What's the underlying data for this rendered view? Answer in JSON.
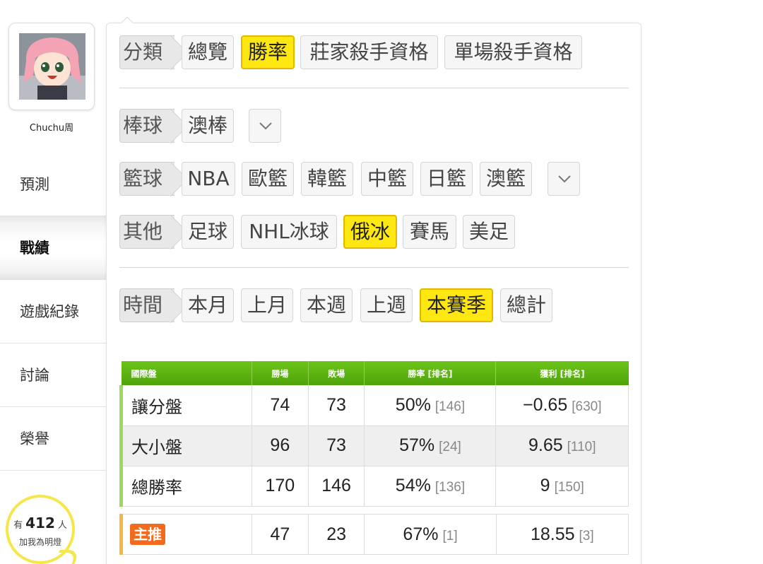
{
  "profile": {
    "username": "Chuchu周"
  },
  "nav": {
    "items": [
      {
        "label": "預測",
        "active": false
      },
      {
        "label": "戰績",
        "active": true
      },
      {
        "label": "遊戲紀錄",
        "active": false
      },
      {
        "label": "討論",
        "active": false
      },
      {
        "label": "榮譽",
        "active": false
      }
    ]
  },
  "fans": {
    "prefix": "有",
    "count": "412",
    "suffix": "人",
    "cta": "加我為明燈"
  },
  "filters": {
    "category": {
      "label": "分類",
      "options": [
        "總覽",
        "勝率",
        "莊家殺手資格",
        "單場殺手資格"
      ],
      "selected": "勝率"
    },
    "baseball": {
      "label": "棒球",
      "options": [
        "澳棒"
      ],
      "dropdown_icon": "chevron-down-icon"
    },
    "basketball": {
      "label": "籃球",
      "options": [
        "NBA",
        "歐籃",
        "韓籃",
        "中籃",
        "日籃",
        "澳籃"
      ],
      "dropdown_icon": "chevron-down-icon"
    },
    "other": {
      "label": "其他",
      "options": [
        "足球",
        "NHL冰球",
        "俄冰",
        "賽馬",
        "美足"
      ],
      "selected": "俄冰"
    },
    "time": {
      "label": "時間",
      "options": [
        "本月",
        "上月",
        "本週",
        "上週",
        "本賽季",
        "總計"
      ],
      "selected": "本賽季"
    }
  },
  "table": {
    "headers": [
      "國際盤",
      "勝場",
      "敗場",
      "勝率 [排名]",
      "獲利 [排名]"
    ],
    "rows": [
      {
        "name": "讓分盤",
        "wins": "74",
        "losses": "73",
        "rate": "50%",
        "rate_rank": "[146]",
        "profit": "−0.65",
        "profit_rank": "[630]"
      },
      {
        "name": "大小盤",
        "wins": "96",
        "losses": "73",
        "rate": "57%",
        "rate_rank": "[24]",
        "profit": "9.65",
        "profit_rank": "[110]"
      },
      {
        "name": "總勝率",
        "wins": "170",
        "losses": "146",
        "rate": "54%",
        "rate_rank": "[136]",
        "profit": "9",
        "profit_rank": "[150]"
      }
    ],
    "featured": {
      "badge": "主推",
      "wins": "47",
      "losses": "23",
      "rate": "67%",
      "rate_rank": "[1]",
      "profit": "18.55",
      "profit_rank": "[3]"
    }
  },
  "colors": {
    "selected_chip": "#ffe812",
    "header_green": "#5bb312",
    "badge_orange": "#f26a1b",
    "fans_ring": "#f5e64a"
  }
}
